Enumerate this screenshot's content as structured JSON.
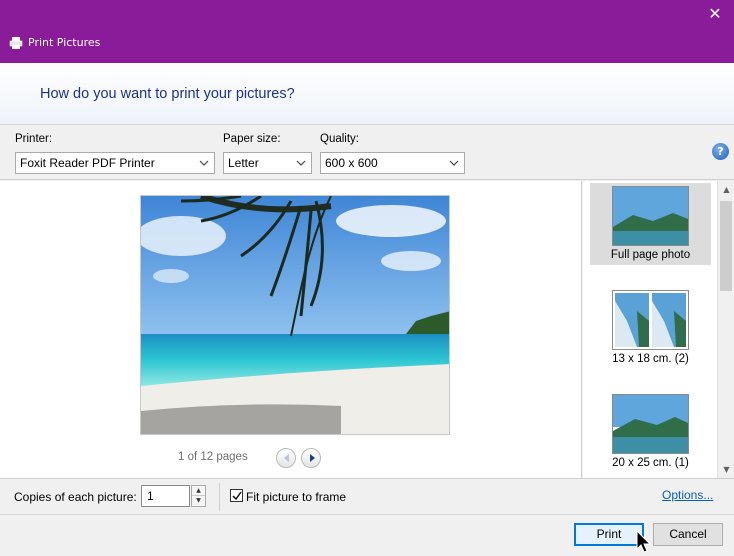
{
  "window": {
    "title": "Print Pictures",
    "close_glyph": "✕"
  },
  "header": {
    "question": "How do you want to print your pictures?"
  },
  "options": {
    "printer_label": "Printer:",
    "printer_value": "Foxit Reader PDF Printer",
    "paper_label": "Paper size:",
    "paper_value": "Letter",
    "quality_label": "Quality:",
    "quality_value": "600 x 600",
    "help_glyph": "?"
  },
  "preview": {
    "pages_text": "1 of 12 pages"
  },
  "layouts": [
    {
      "label": "Full page photo",
      "selected": true
    },
    {
      "label": "13 x 18 cm. (2)",
      "selected": false
    },
    {
      "label": "20 x 25 cm. (1)",
      "selected": false
    }
  ],
  "bottom": {
    "copies_label": "Copies of each picture:",
    "copies_value": "1",
    "fit_label": "Fit picture to frame",
    "fit_checked": true,
    "options_link": "Options..."
  },
  "buttons": {
    "print": "Print",
    "cancel": "Cancel"
  },
  "colors": {
    "titlebar": "#8a1c99",
    "link": "#0a5dba",
    "heading": "#1e3287"
  },
  "icons": {
    "app": "printer-icon",
    "help": "help-icon",
    "prev": "chevron-left-icon",
    "next": "chevron-right-icon"
  }
}
